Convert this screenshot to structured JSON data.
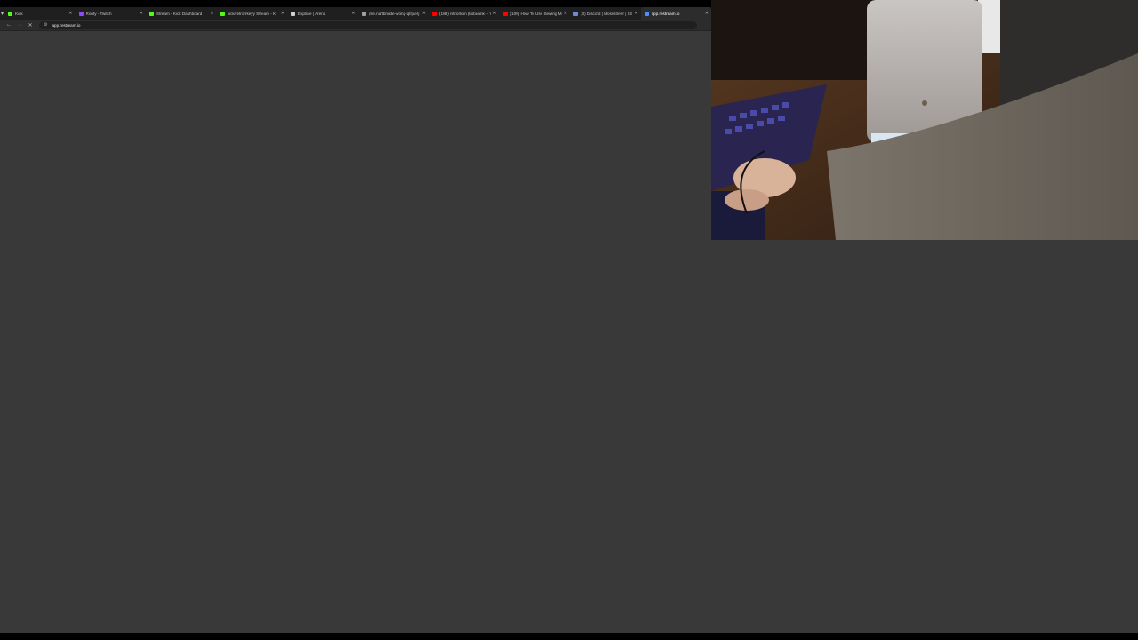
{
  "browser": {
    "tabs": [
      {
        "title": "Kick",
        "favicon_color": "#53fc18",
        "active": false
      },
      {
        "title": "Rooty - Twitch",
        "favicon_color": "#9146ff",
        "active": false
      },
      {
        "title": "Stream - Kick Dashboard",
        "favicon_color": "#53fc18",
        "active": false
      },
      {
        "title": "nick/retrorrkeyy Stream - Ki",
        "favicon_color": "#53fc18",
        "active": false
      },
      {
        "title": "Explore | Arena",
        "favicon_color": "#d0d0d0",
        "active": false
      },
      {
        "title": "jme.na/tbridde-wong-qtl|uerj",
        "favicon_color": "#9aa0a6",
        "active": false
      },
      {
        "title": "(189) retrorhon (sobeank) - Yo",
        "favicon_color": "#ff0000",
        "active": false
      },
      {
        "title": "(109) How To Use Sewing Ma",
        "favicon_color": "#ff0000",
        "active": false
      },
      {
        "title": "(3) Discord | Mossstreer | SST",
        "favicon_color": "#7289da",
        "active": false
      },
      {
        "title": "app.restream.io",
        "favicon_color": "#4e8cff",
        "active": true
      }
    ],
    "address_bar": {
      "url": "app.restream.io"
    },
    "icons": {
      "tab_menu": "chevron-down-icon",
      "back": "back-arrow-icon",
      "forward": "forward-arrow-icon",
      "stop": "stop-icon",
      "site_info": "tune-icon",
      "tab_close": "close-icon"
    }
  },
  "colors": {
    "page_background": "#393939",
    "tabstrip": "#1f1f1f",
    "toolbar": "#2c2c2c"
  }
}
